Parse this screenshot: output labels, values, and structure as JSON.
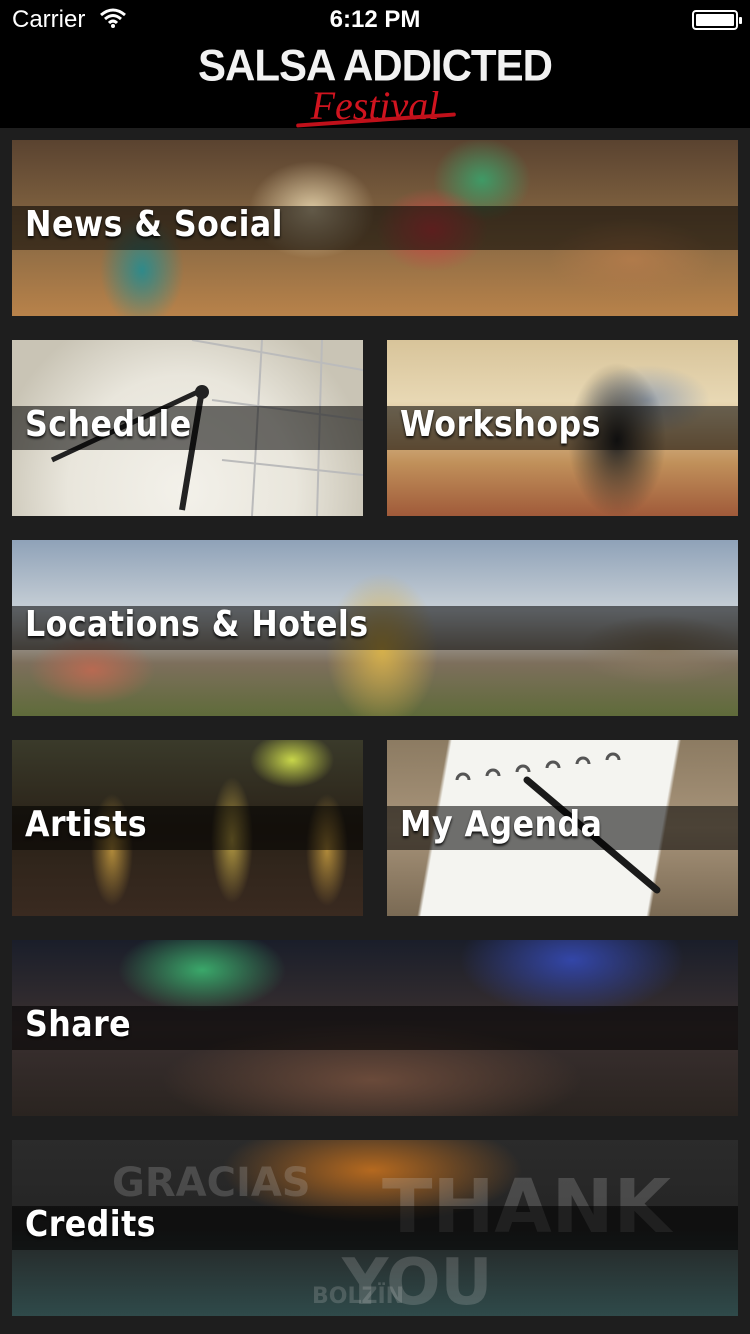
{
  "status_bar": {
    "carrier": "Carrier",
    "time": "6:12 PM",
    "wifi_icon": "wifi-icon",
    "battery_icon": "battery-icon",
    "battery_level": 1.0
  },
  "header": {
    "logo_main": "SALSA ADDICTED",
    "logo_sub": "Festival",
    "accent_color": "#d0141f"
  },
  "tiles": [
    {
      "label": "News & Social"
    },
    {
      "label": "Schedule"
    },
    {
      "label": "Workshops"
    },
    {
      "label": "Locations & Hotels"
    },
    {
      "label": "Artists"
    },
    {
      "label": "My Agenda"
    },
    {
      "label": "Share"
    },
    {
      "label": "Credits"
    }
  ],
  "credits_background_words": [
    "GRACIAS",
    "THANK",
    "YOU",
    "BOLZÏN"
  ]
}
